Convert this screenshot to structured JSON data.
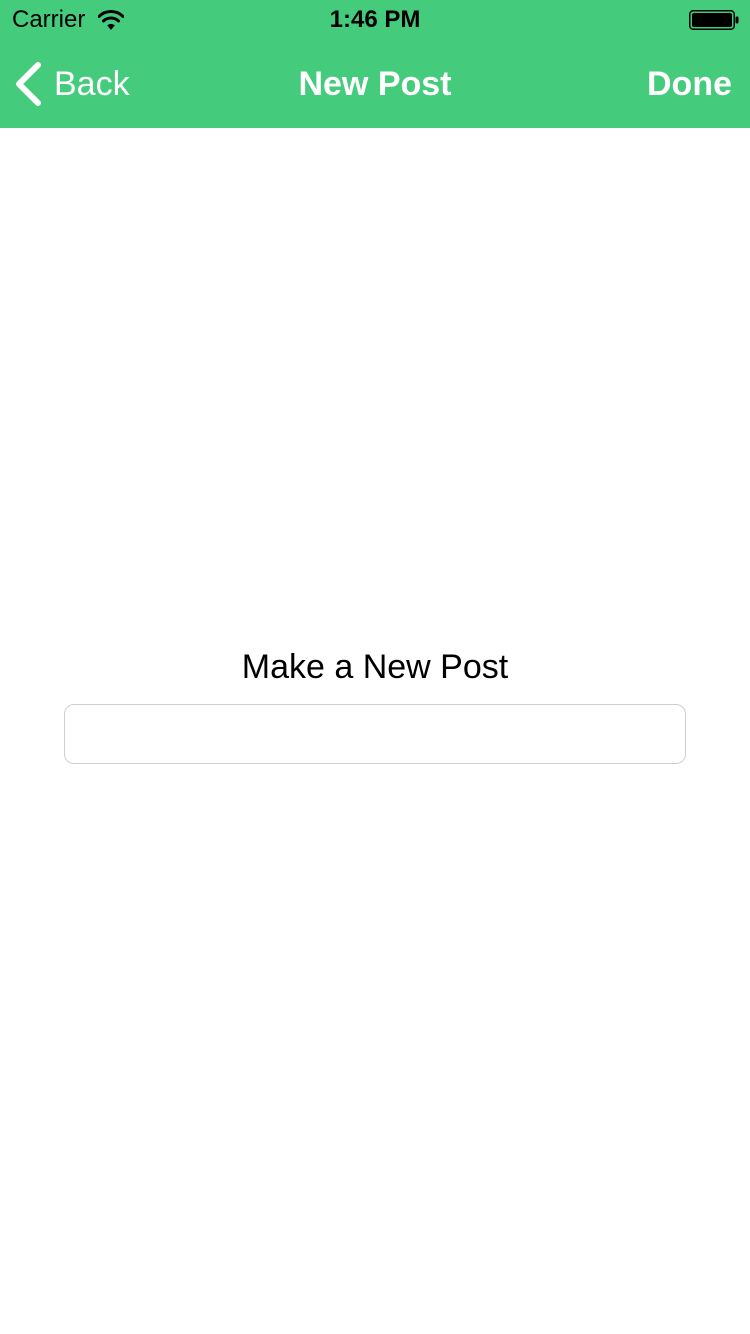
{
  "status_bar": {
    "carrier": "Carrier",
    "time": "1:46 PM",
    "wifi_icon": "wifi-icon",
    "battery_icon": "battery-icon"
  },
  "nav_bar": {
    "back_icon": "chevron-left-icon",
    "back_label": "Back",
    "title": "New Post",
    "done_label": "Done"
  },
  "content": {
    "heading": "Make a New Post",
    "input_value": "",
    "input_placeholder": ""
  },
  "colors": {
    "accent": "#44cb7b",
    "nav_text": "#ffffff",
    "background": "#ffffff",
    "input_border": "#cfcfcf"
  }
}
